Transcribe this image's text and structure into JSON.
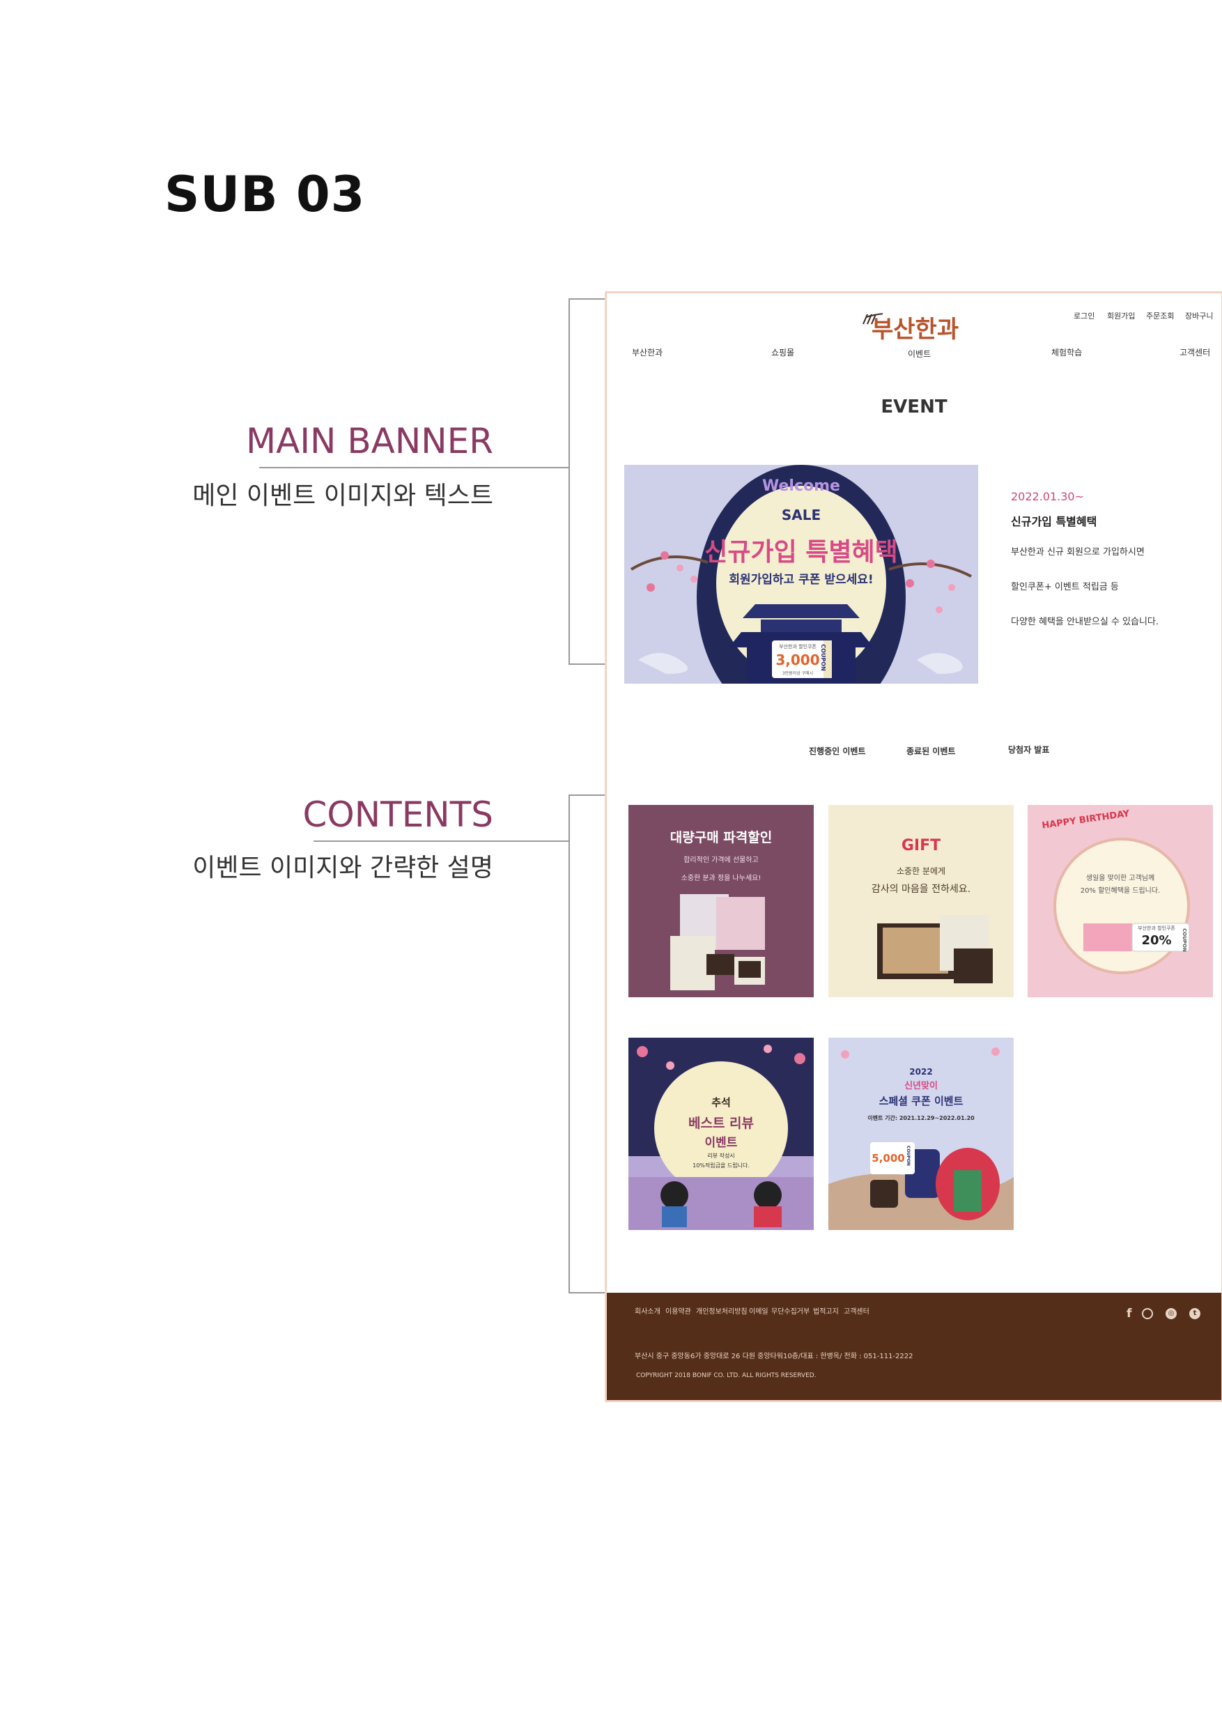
{
  "page_title": "SUB 03",
  "annotations": [
    {
      "title": "MAIN BANNER",
      "desc": "메인 이벤트 이미지와 텍스트"
    },
    {
      "title": "CONTENTS",
      "desc": "이벤트 이미지와  간략한 설명"
    }
  ],
  "mockup": {
    "logo": "부산한과",
    "utility_nav": [
      "로그인",
      "회원가입",
      "주문조회",
      "장바구니"
    ],
    "main_nav": [
      "부산한과",
      "쇼핑몰",
      "이벤트",
      "체험학습",
      "고객센터"
    ],
    "heading": "EVENT",
    "banner": {
      "welcome": "Welcome",
      "sale": "SALE",
      "headline": "신규가입 특별혜택",
      "sub": "회원가입하고 쿠폰 받으세요!",
      "coupon_label": "부산한과 할인쿠폰",
      "coupon_amount": "3,000",
      "coupon_note": "3만원이상 구매시",
      "coupon_side": "COUPON"
    },
    "banner_info": {
      "date": "2022.01.30~",
      "title": "신규가입 특별혜택",
      "lines": [
        "부산한과 신규 회원으로 가입하시면",
        "할인쿠폰+ 이벤트 적립금 등",
        "다양한 혜택을 안내받으실 수 있습니다."
      ]
    },
    "tabs": [
      "진행중인 이벤트",
      "종료된 이벤트",
      "당첨자 발표"
    ],
    "cards": [
      {
        "title": "대량구매 파격할인",
        "sub1": "합리적인 가격에 선물하고",
        "sub2": "소중한 분과 정을 나누세요!"
      },
      {
        "title": "GIFT",
        "sub1": "소중한 분에게",
        "sub2": "감사의 마음을 전하세요."
      },
      {
        "title": "HAPPY BIRTHDAY",
        "sub1": "생일을 맞이한 고객님께",
        "sub2": "20% 할인혜택을 드립니다.",
        "coupon_label": "부산한과 할인쿠폰",
        "coupon_amount": "20%",
        "coupon_side": "COUPON"
      },
      {
        "title1": "추석",
        "title2": "베스트 리뷰",
        "title3": "이벤트",
        "sub1": "리뷰 작성시",
        "sub2": "10%적립금을 드립니다."
      },
      {
        "year": "2022",
        "title1": "신년맞이",
        "title2": "스페셜 쿠폰 이벤트",
        "period": "이벤트 기간: 2021.12.29~2022.01.20",
        "coupon_amount": "5,000",
        "coupon_side": "COUPON"
      }
    ],
    "footer": {
      "links": [
        "회사소개",
        "이용약관",
        "개인정보처리방침",
        "이메일",
        "무단수집거부",
        "법적고지",
        "고객센터"
      ],
      "address": "부산시 중구 중앙동6가 중앙대로 26 다원 중앙타워10층/대표 : 한병옥/ 전화 : 051-111-2222",
      "copyright": "COPYRIGHT 2018 BONIF CO. LTD. ALL RIGHTS RESERVED.",
      "sns_icons": [
        "facebook-icon",
        "instagram-outline-icon",
        "instagram-icon",
        "twitter-icon"
      ]
    }
  }
}
